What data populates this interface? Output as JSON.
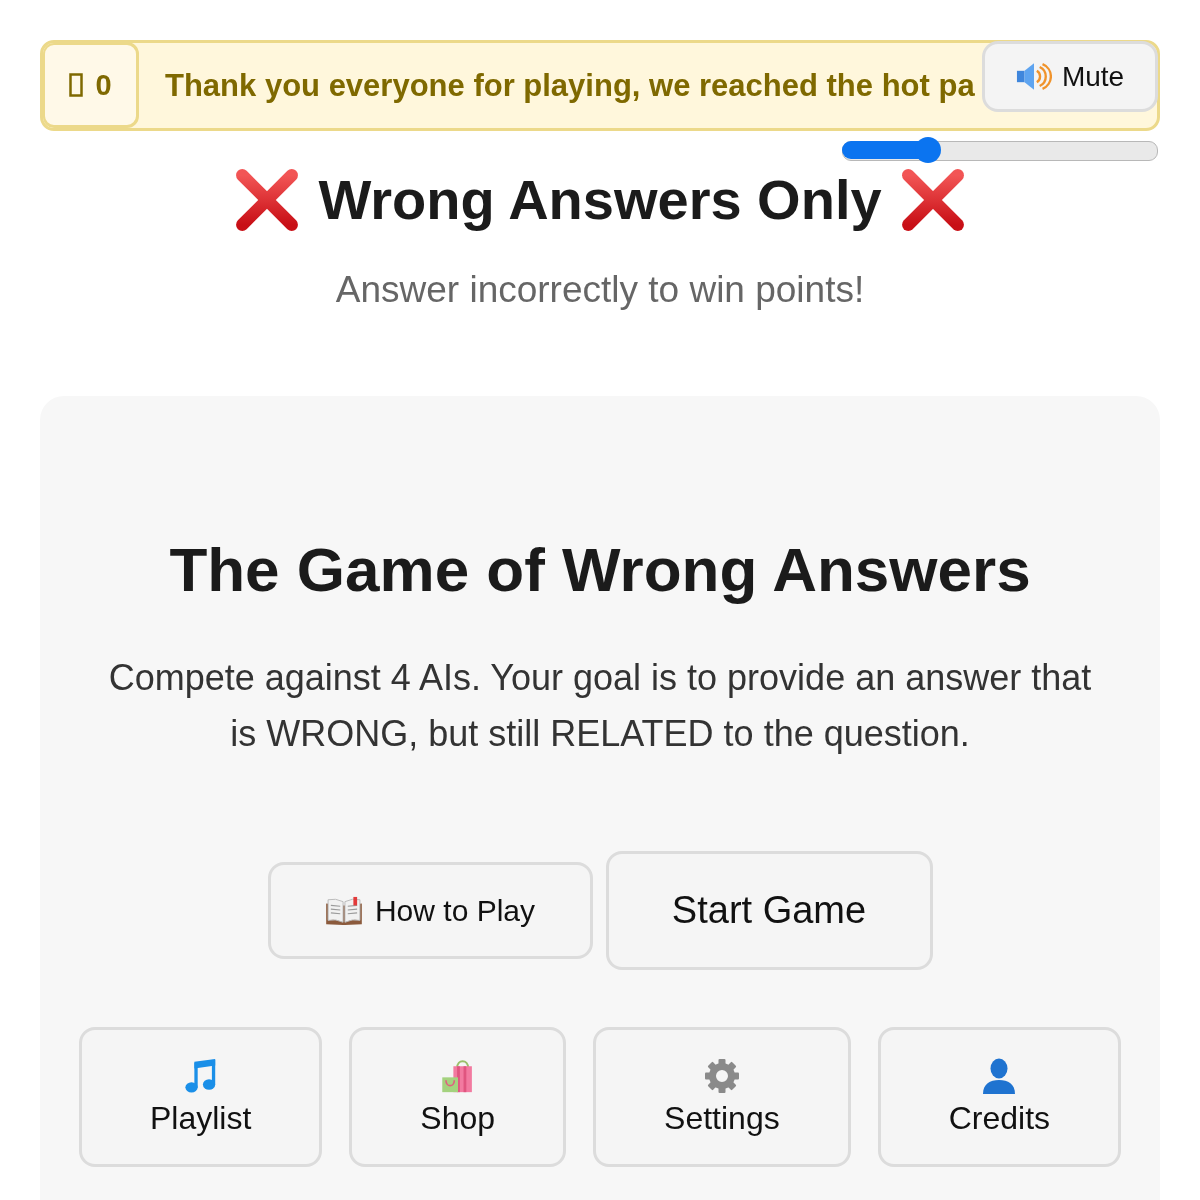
{
  "announcement": {
    "score": "0",
    "message": "Thank you everyone for playing, we reached the hot pa"
  },
  "audio": {
    "mute_label": "Mute",
    "volume": {
      "level": 0.25
    }
  },
  "header": {
    "title": "Wrong Answers Only",
    "subtitle": "Answer incorrectly to win points!"
  },
  "intro_card": {
    "title": "The Game of Wrong Answers",
    "description": "Compete against 4 AIs. Your goal is to provide an answer that is WRONG, but still RELATED to the question.",
    "actions": [
      {
        "kind": "guide",
        "label": "How to Play"
      },
      {
        "kind": "start",
        "label": "Start Game"
      }
    ],
    "menu": [
      {
        "kind": "playlist",
        "label": "Playlist"
      },
      {
        "kind": "shop",
        "label": "Shop"
      },
      {
        "kind": "settings",
        "label": "Settings"
      },
      {
        "kind": "credits",
        "label": "Credits"
      }
    ]
  }
}
